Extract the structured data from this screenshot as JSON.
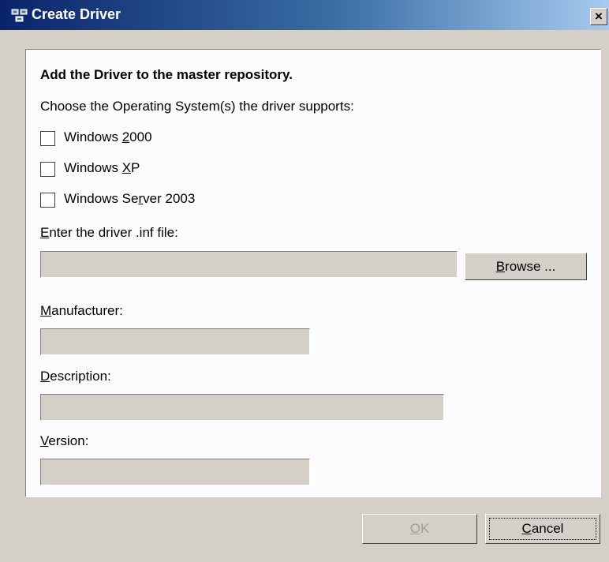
{
  "window": {
    "title": "Create Driver",
    "close_glyph": "×",
    "app_icon": "network-computers-icon"
  },
  "form": {
    "heading": "Add the Driver to the master repository.",
    "os_prompt": "Choose the Operating System(s) the driver supports:",
    "os_options": [
      {
        "pre": "Windows ",
        "mn": "2",
        "post": "000",
        "checked": false
      },
      {
        "pre": "Windows ",
        "mn": "X",
        "post": "P",
        "checked": false
      },
      {
        "pre": "Windows Se",
        "mn": "r",
        "post": "ver 2003",
        "checked": false
      }
    ],
    "inf": {
      "label_mn": "E",
      "label_rest": "nter the driver .inf file:",
      "value": ""
    },
    "browse": {
      "mn": "B",
      "rest": "rowse ..."
    },
    "manufacturer": {
      "label_mn": "M",
      "label_rest": "anufacturer:",
      "value": ""
    },
    "description": {
      "label_mn": "D",
      "label_rest": "escription:",
      "value": ""
    },
    "version": {
      "label_mn": "V",
      "label_rest": "ersion:",
      "value": ""
    }
  },
  "buttons": {
    "ok": {
      "mn": "O",
      "rest": "K",
      "enabled": false
    },
    "cancel": {
      "mn": "C",
      "rest": "ancel",
      "enabled": true
    }
  }
}
